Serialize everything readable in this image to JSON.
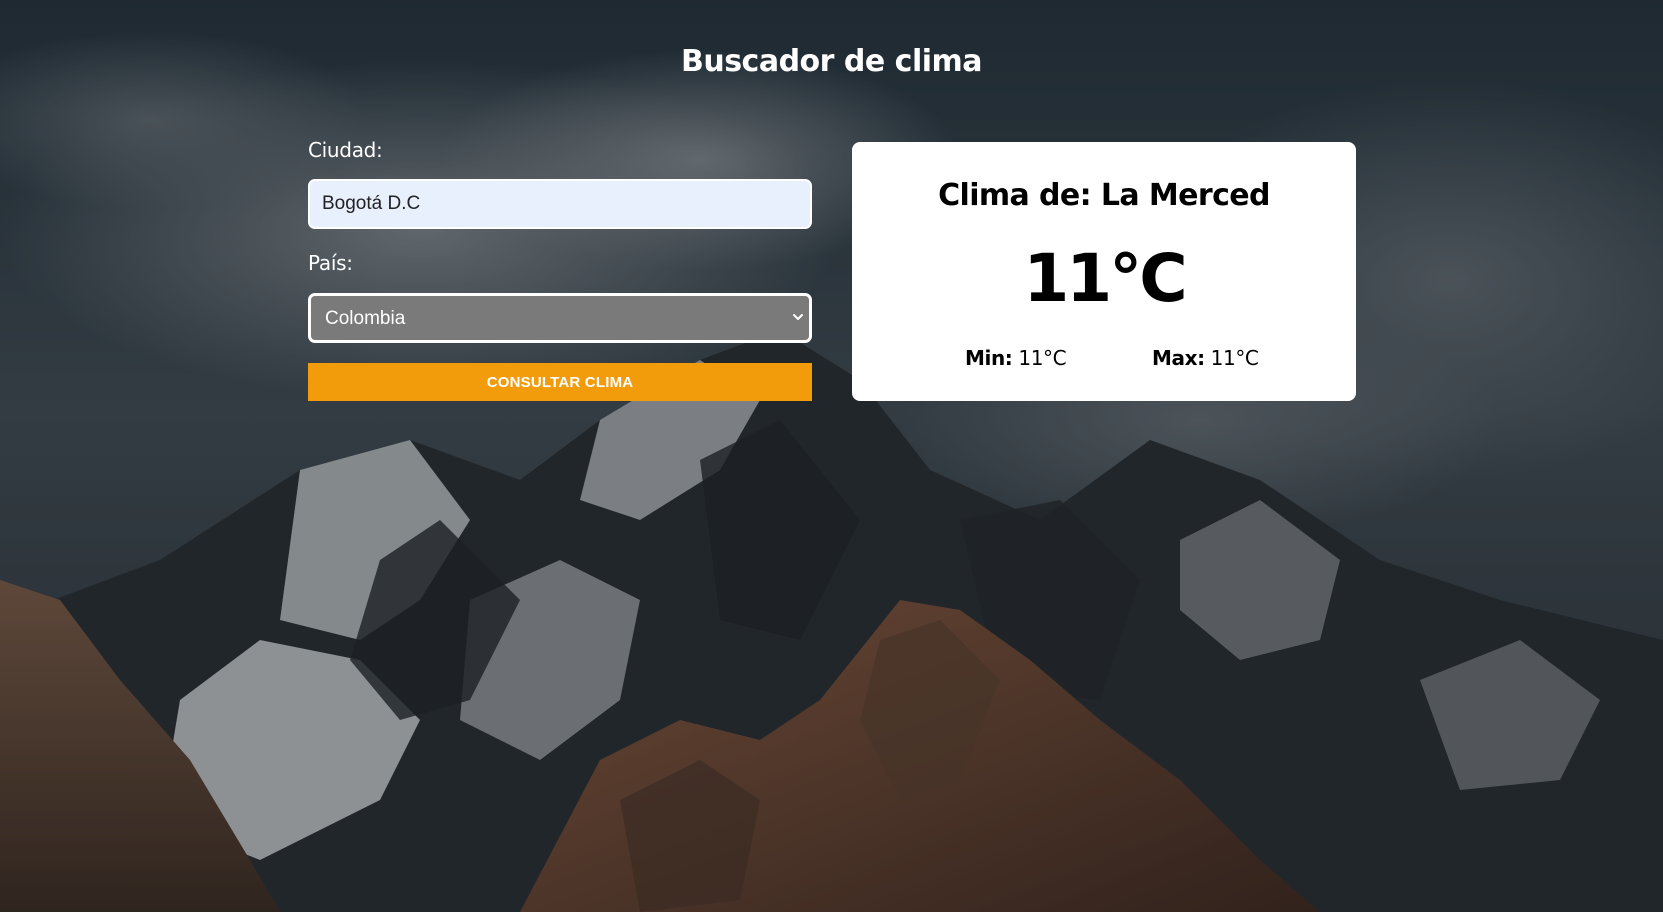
{
  "page": {
    "title": "Buscador de clima"
  },
  "form": {
    "city_label": "Ciudad:",
    "city_value": "Bogotá D.C",
    "country_label": "País:",
    "country_selected": "Colombia",
    "submit_label": "CONSULTAR CLIMA"
  },
  "result": {
    "title": "Clima de: La Merced",
    "temperature": "11°C",
    "min_label": "Min:",
    "min_value": "11°C",
    "max_label": "Max:",
    "max_value": "11°C"
  },
  "colors": {
    "button": "#f29c0c",
    "input_background": "#e8f0fe",
    "select_background": "#7a7a7a",
    "card_background": "#ffffff"
  },
  "icons": {
    "select_arrow": "chevron-down-icon"
  }
}
